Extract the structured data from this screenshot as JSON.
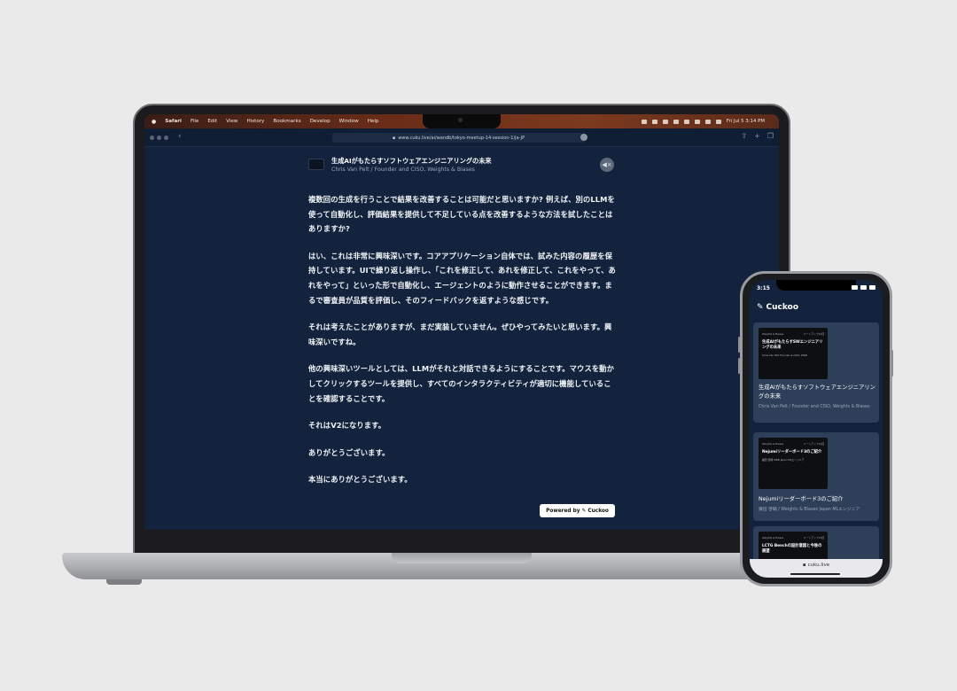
{
  "laptop": {
    "menubar": {
      "items": [
        "Safari",
        "File",
        "Edit",
        "View",
        "History",
        "Bookmarks",
        "Develop",
        "Window",
        "Help"
      ],
      "clock": "Fri Jul 5  3:14 PM"
    },
    "browser": {
      "url": "www.cuku.live/ai/wandb/tokyo-meetup-14-session-1/ja-JP"
    },
    "session": {
      "title": "生成AIがもたらすソフトウェアエンジニアリングの未来",
      "speaker": "Chris Van Pelt / Founder and CISO, Weights & Biases"
    },
    "transcript": [
      "複数回の生成を行うことで結果を改善することは可能だと思いますか? 例えば、別のLLMを使って自動化し、評価結果を提供して不足している点を改善するような方法を試したことはありますか?",
      "はい、これは非常に興味深いです。コアアプリケーション自体では、試みた内容の履歴を保持しています。UIで繰り返し操作し、「これを修正して、あれを修正して、これをやって、あれをやって」といった形で自動化し、エージェントのように動作させることができます。まるで審査員が品質を評価し、そのフィードバックを返すような感じです。",
      "それは考えたことがありますが、まだ実装していません。ぜひやってみたいと思います。興味深いですね。",
      "他の興味深いツールとしては、LLMがそれと対話できるようにすることです。マウスを動かしてクリックするツールを提供し、すべてのインタラクティビティが適切に機能していることを確認することです。",
      "それはV2になります。",
      "ありがとうございます。",
      "本当にありがとうございます。"
    ],
    "powered_by": "Powered by",
    "brand": "Cuckoo"
  },
  "phone": {
    "time": "3:15",
    "brand": "Cuckoo",
    "footer_url": "cuku.live",
    "cards": [
      {
        "thumb_tag_left": "Weights & Biases",
        "thumb_tag_right": "ミートアップ14回",
        "thumb_title": "生成AIがもたらすSWエンジニアリングの未来",
        "thumb_sub": "Chris Van Pelt Founder & CISO, W&B",
        "title": "生成AIがもたらすソフトウェアエンジニアリングの未来",
        "subtitle": "Chris Van Pelt / Founder and CISO, Weights & Biases"
      },
      {
        "thumb_tag_left": "Weights & Biases",
        "thumb_tag_right": "ミートアップ14回",
        "thumb_title": "Nejumiリーダーボード3のご紹介",
        "thumb_sub": "鎌田 啓輔 W&B Japan MLエンジニア",
        "title": "Nejumiリーダーボード3のご紹介",
        "subtitle": "鎌田 啓輔 / Weights & Biases Japan MLエンジニア"
      },
      {
        "thumb_tag_left": "Weights & Biases",
        "thumb_tag_right": "ミートアップ14回",
        "thumb_title": "LCTG Benchの設計意図と今後の展望",
        "thumb_sub": "",
        "title": "",
        "subtitle": ""
      }
    ]
  },
  "colors": {
    "background": "#ebeaea",
    "screen": "#13233d",
    "card": "#2e3f59",
    "menubar": "#6b2d18"
  }
}
